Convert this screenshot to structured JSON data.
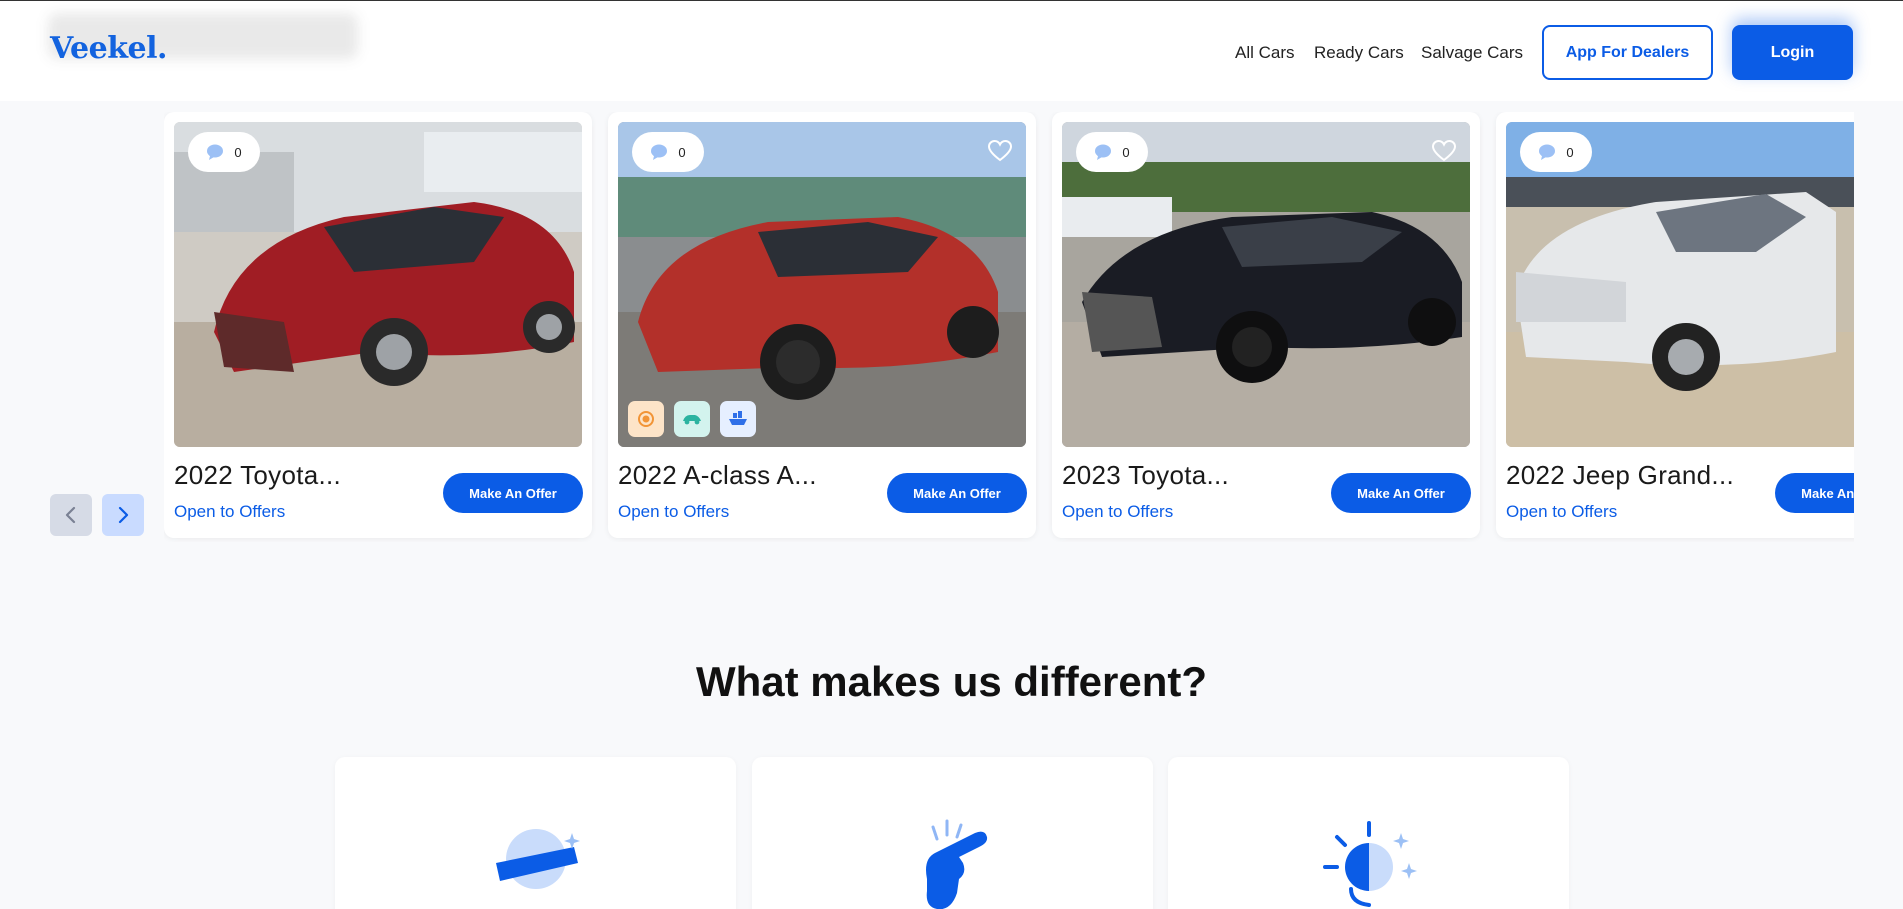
{
  "header": {
    "logo": "Veekel.",
    "nav": [
      "All Cars",
      "Ready Cars",
      "Salvage Cars"
    ],
    "dealers_button": "App For Dealers",
    "login_button": "Login"
  },
  "cards": [
    {
      "title": "2022 Toyota...",
      "status": "Open to Offers",
      "offer_button": "Make An Offer",
      "comments": "0",
      "body_color": "#a01d24"
    },
    {
      "title": "2022  A-class A...",
      "status": "Open to Offers",
      "offer_button": "Make An Offer",
      "comments": "0",
      "body_color": "#b3302a"
    },
    {
      "title": "2023 Toyota...",
      "status": "Open to Offers",
      "offer_button": "Make An Offer",
      "comments": "0",
      "body_color": "#1a1c24"
    },
    {
      "title": "2022 Jeep Grand...",
      "status": "Open to Offers",
      "offer_button": "Make An Offer",
      "comments": "0",
      "body_color": "#e6e8ea"
    }
  ],
  "section": {
    "title": "What makes us different?"
  },
  "colors": {
    "brand": "#0b5ce6",
    "logo": "#1363df"
  }
}
